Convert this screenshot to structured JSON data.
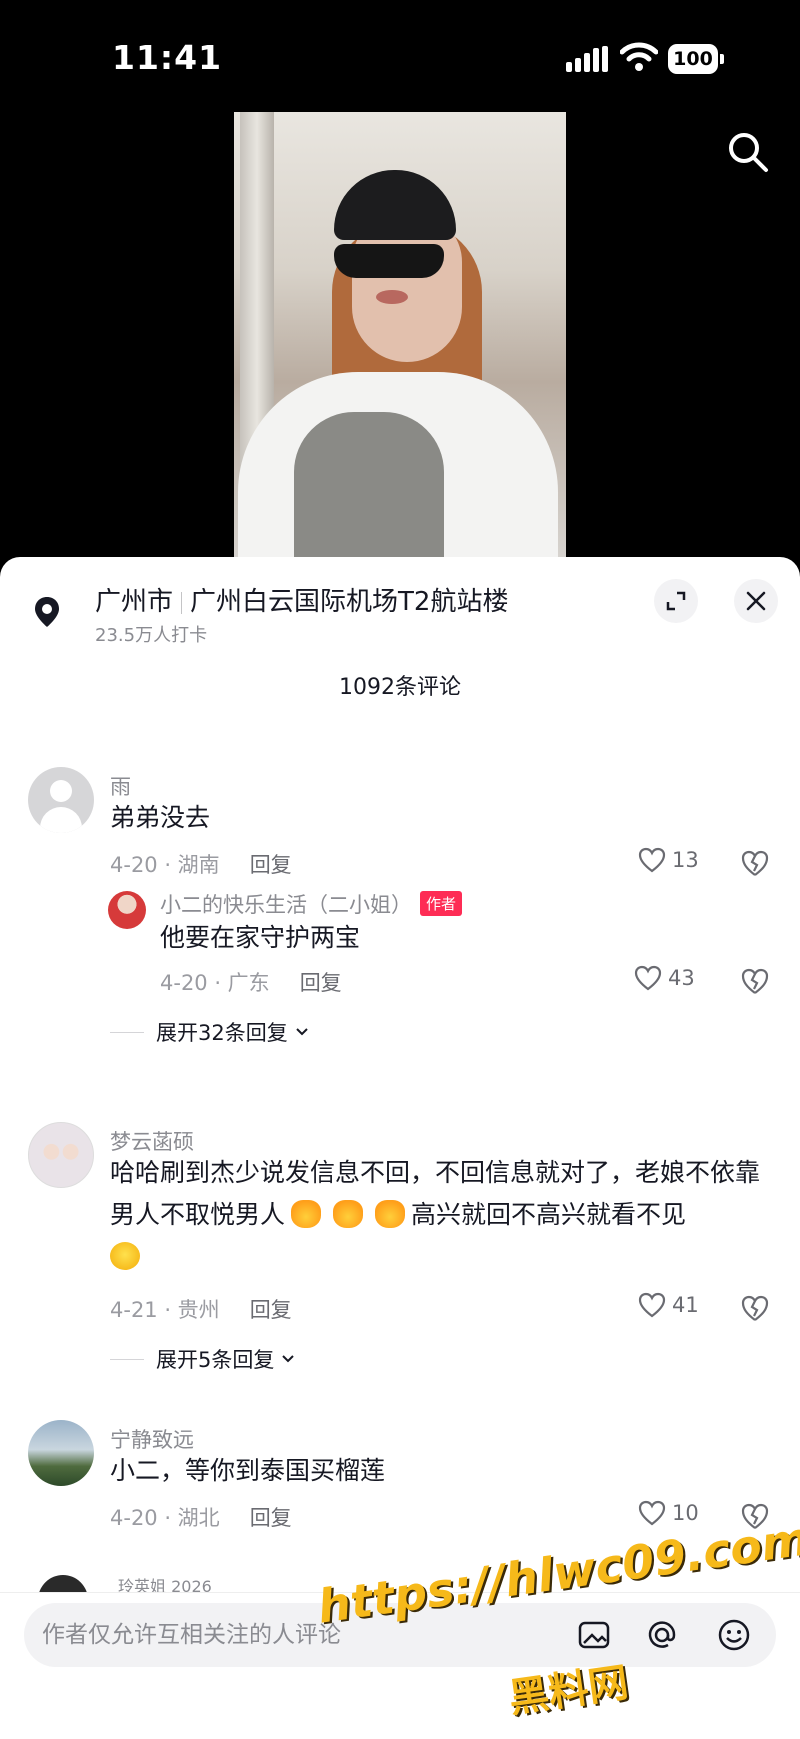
{
  "status_bar": {
    "time": "11:41",
    "battery": "100"
  },
  "location": {
    "city": "广州市",
    "place": "广州白云国际机场T2航站楼",
    "checkins": "23.5万人打卡"
  },
  "comments_count": "1092条评论",
  "comments": [
    {
      "username": "雨",
      "text": "弟弟没去",
      "date_region": "4-20 · 湖南",
      "reply_label": "回复",
      "likes": "13",
      "replies": [
        {
          "username": "小二的快乐生活（二小姐）",
          "badge": "作者",
          "text": "他要在家守护两宝",
          "date_region": "4-20 · 广东",
          "reply_label": "回复",
          "likes": "43"
        }
      ],
      "expand_label": "展开32条回复"
    },
    {
      "username": "梦云菡硕",
      "text_part1": "哈哈刷到杰少说发信息不回，不回信息就对了，老娘不依靠男人不取悦男人",
      "text_part2": "高兴就回不高兴就看不见",
      "date_region": "4-21 · 贵州",
      "reply_label": "回复",
      "likes": "41",
      "expand_label": "展开5条回复"
    },
    {
      "username": "宁静致远",
      "text": "小二，等你到泰国买榴莲",
      "date_region": "4-20 · 湖北",
      "reply_label": "回复",
      "likes": "10"
    },
    {
      "username": "玲英姐 2026"
    }
  ],
  "input": {
    "placeholder": "作者仅允许互相关注的人评论"
  },
  "watermark": {
    "line1": "https://hlwc09.com",
    "line2": "黑料网"
  },
  "icons": {
    "search": "search-icon",
    "pin": "location-pin-icon",
    "expand": "expand-icon",
    "close": "close-icon",
    "heart": "heart-icon",
    "dislike": "broken-heart-icon",
    "image": "image-icon",
    "at": "at-icon",
    "emoji": "emoji-icon"
  }
}
